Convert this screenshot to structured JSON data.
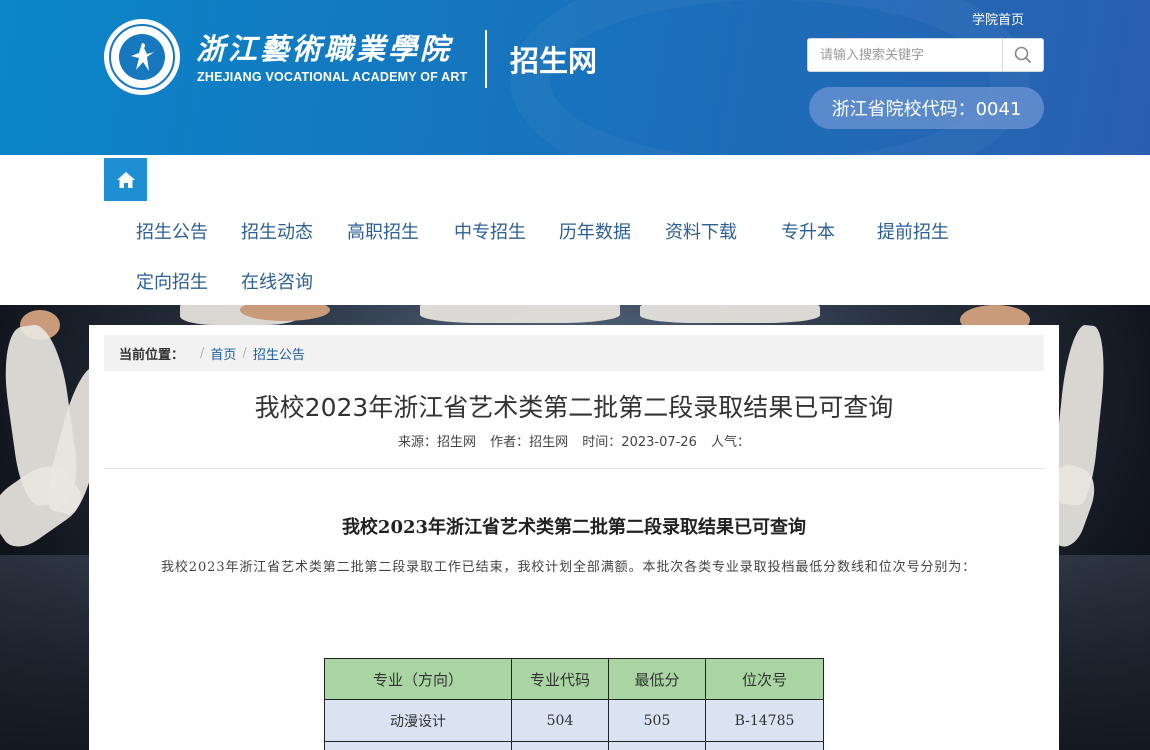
{
  "header": {
    "school_name_cn": "浙江藝術職業學院",
    "school_name_en": "ZHEJIANG VOCATIONAL ACADEMY OF ART",
    "site_name": "招生网",
    "college_home_link": "学院首页",
    "search": {
      "placeholder": "请输入搜索关键字",
      "value": ""
    },
    "school_code": "浙江省院校代码：0041"
  },
  "nav": {
    "items": [
      "招生公告",
      "招生动态",
      "高职招生",
      "中专招生",
      "历年数据",
      "资料下载",
      "专升本",
      "提前招生",
      "定向招生",
      "在线咨询"
    ]
  },
  "breadcrumb": {
    "label": "当前位置：",
    "separator": "/",
    "items": [
      "首页",
      "招生公告"
    ]
  },
  "article": {
    "title": "我校2023年浙江省艺术类第二批第二段录取结果已可查询",
    "meta": {
      "source": "来源：招生网",
      "author": "作者：招生网",
      "time": "时间：2023-07-26",
      "views": "人气："
    },
    "body_title": "我校2023年浙江省艺术类第二批第二段录取结果已可查询",
    "body_paragraph": "我校2023年浙江省艺术类第二批第二段录取工作已结束，我校计划全部满额。本批次各类专业录取投档最低分数线和位次号分别为：",
    "table": {
      "headers": [
        "专业（方向）",
        "专业代码",
        "最低分",
        "位次号"
      ],
      "rows": [
        [
          "动漫设计",
          "504",
          "505",
          "B-14785"
        ]
      ]
    }
  },
  "colors": {
    "header_blue": "#1674bd",
    "nav_text": "#2c5f94",
    "home_button": "#1f8fd3",
    "table_header_bg": "#a8d5a2",
    "table_cell_bg": "#d9e3f2"
  }
}
